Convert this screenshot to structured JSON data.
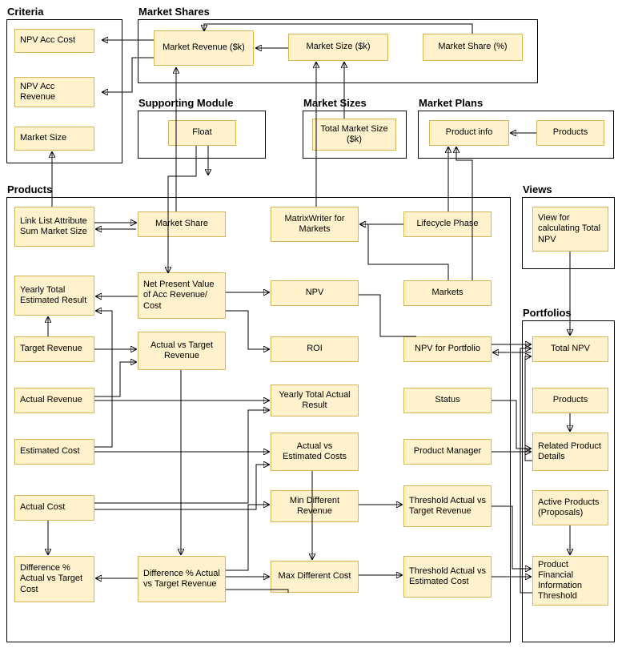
{
  "groups": {
    "criteria": {
      "title": "Criteria"
    },
    "market_shares": {
      "title": "Market Shares"
    },
    "supporting_module": {
      "title": "Supporting Module"
    },
    "market_sizes": {
      "title": "Market Sizes"
    },
    "market_plans": {
      "title": "Market Plans"
    },
    "products": {
      "title": "Products"
    },
    "views": {
      "title": "Views"
    },
    "portfolios": {
      "title": "Portfolios"
    }
  },
  "nodes": {
    "npv_acc_cost": "NPV Acc Cost",
    "npv_acc_revenue": "NPV Acc Revenue",
    "criteria_market_size": "Market Size",
    "market_revenue_k": "Market Revenue ($k)",
    "market_size_k": "Market Size ($k)",
    "market_share_pct": "Market Share (%)",
    "float": "Float",
    "total_market_size_k": "Total Market Size ($k)",
    "product_info": "Product info",
    "mp_products": "Products",
    "link_list_attr_sum": "Link List Attribute Sum Market Size",
    "market_share": "Market Share",
    "matrix_writer": "MatrixWriter for Markets",
    "lifecycle_phase": "Lifecycle Phase",
    "view_total_npv": "View for calculating Total NPV",
    "yearly_total_est": "Yearly Total Estimated Result",
    "npv_acc_rev_cost": "Net Present Value of Acc Revenue/ Cost",
    "npv": "NPV",
    "markets": "Markets",
    "target_revenue": "Target Revenue",
    "actual_vs_target_rev": "Actual vs Target Revenue",
    "roi": "ROI",
    "npv_portfolio": "NPV for Portfolio",
    "actual_revenue": "Actual Revenue",
    "yearly_total_actual": "Yearly Total Actual Result",
    "status": "Status",
    "estimated_cost": "Estimated Cost",
    "actual_vs_est_costs": "Actual vs Estimated Costs",
    "product_manager": "Product Manager",
    "actual_cost": "Actual Cost",
    "min_diff_revenue": "Min Different Revenue",
    "threshold_target_rev": "Threshold Actual vs Target Revenue",
    "diff_pct_target_cost": "Difference % Actual vs Target Cost",
    "diff_pct_target_rev": "Difference % Actual vs Target Revenue",
    "max_diff_cost": "Max Different Cost",
    "threshold_est_cost": "Threshold Actual vs Estimated Cost",
    "total_npv": "Total NPV",
    "pf_products": "Products",
    "related_details": "Related Product Details",
    "active_products": "Active Products (Proposals)",
    "pf_threshold": "Product Financial Information Threshold"
  }
}
